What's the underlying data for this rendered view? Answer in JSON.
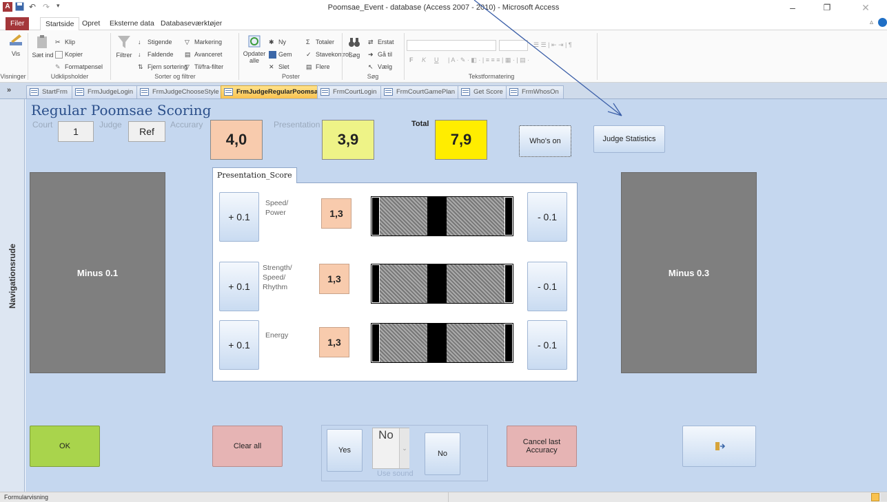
{
  "window": {
    "title": "Poomsae_Event - database (Access 2007 - 2010) - Microsoft Access",
    "app_icon": "A"
  },
  "ribbon_tabs": [
    "Filer",
    "Startside",
    "Opret",
    "Eksterne data",
    "Databaseværktøjer"
  ],
  "ribbon": {
    "vis": {
      "label": "Vis",
      "group": "Visninger"
    },
    "clipboard": {
      "paste": "Sæt ind",
      "cut": "Klip",
      "copy": "Kopier",
      "format": "Formatpensel",
      "group": "Udklipsholder"
    },
    "sort": {
      "filter": "Filtrer",
      "asc": "Stigende",
      "desc": "Faldende",
      "remove": "Fjern sortering",
      "marking": "Markering",
      "advanced": "Avanceret",
      "toggle": "Til/fra-filter",
      "group": "Sorter og filtrer"
    },
    "records": {
      "refresh": "Opdater alle",
      "new": "Ny",
      "save": "Gem",
      "delete": "Slet",
      "totals": "Totaler",
      "spell": "Stavekontrol",
      "more": "Flere",
      "group": "Poster"
    },
    "find": {
      "search": "Søg",
      "replace": "Erstat",
      "goto": "Gå til",
      "select": "Vælg",
      "group": "Søg"
    },
    "text": {
      "group": "Tekstformatering",
      "bold": "F",
      "italic": "K",
      "underline": "U"
    }
  },
  "doc_tabs": [
    {
      "label": "StartFrm",
      "active": false
    },
    {
      "label": "FrmJudgeLogin",
      "active": false
    },
    {
      "label": "FrmJudgeChooseStyle",
      "active": false
    },
    {
      "label": "FrmJudgeRegularPoomsae",
      "active": true
    },
    {
      "label": "FrmCourtLogin",
      "active": false
    },
    {
      "label": "FrmCourtGamePlan",
      "active": false
    },
    {
      "label": "Get Score",
      "active": false
    },
    {
      "label": "FrmWhosOn",
      "active": false
    }
  ],
  "nav_pane": {
    "label": "Navigationsrude",
    "toggle": "»"
  },
  "form": {
    "title": "Regular Poomsae Scoring",
    "court_label": "Court",
    "court_value": "1",
    "judge_label": "Judge",
    "judge_value": "Ref",
    "accuracy_label": "Accurary",
    "accuracy_value": "4,0",
    "presentation_label": "Presentation",
    "presentation_value": "3,9",
    "total_label": "Total",
    "total_value": "7,9",
    "whos_on": "Who's on",
    "judge_statistics": "Judge Statistics",
    "minus_01": "Minus 0.1",
    "minus_03": "Minus 0.3",
    "presentation_tab": "Presentation_Score",
    "rows": [
      {
        "label": "Speed/\nPower",
        "plus": "+ 0.1",
        "score": "1,3",
        "minus": "- 0.1",
        "level": 0.45
      },
      {
        "label": "Strength/\nSpeed/\nRhythm",
        "plus": "+ 0.1",
        "score": "1,3",
        "minus": "- 0.1",
        "level": 0.45
      },
      {
        "label": "Energy",
        "plus": "+ 0.1",
        "score": "1,3",
        "minus": "- 0.1",
        "level": 0.45
      }
    ],
    "ok": "OK",
    "clear_all": "Clear all",
    "sound": {
      "yes": "Yes",
      "no": "No",
      "value": "No",
      "caption": "Use sound"
    },
    "cancel_last": "Cancel last\nAccuracy"
  },
  "status": {
    "text": "Formularvisning"
  },
  "colors": {
    "form_bg": "#c5d7ef",
    "accuracy": "#f8cbad",
    "presentation": "#eef387",
    "total": "#ffed00",
    "ok": "#a9d44c",
    "red_btn": "#e6b4b4"
  }
}
